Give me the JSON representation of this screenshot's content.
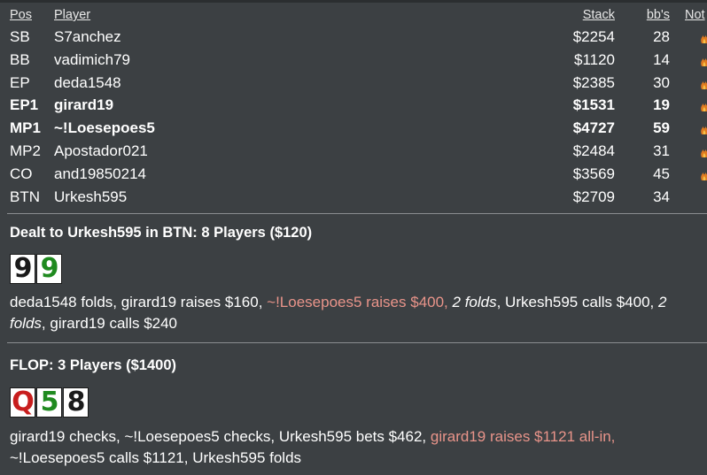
{
  "header": {
    "pos": "Pos",
    "player": "Player",
    "stack": "Stack",
    "bbs": "bb's",
    "notes": "Not"
  },
  "players": [
    {
      "pos": "SB",
      "player": "S7anchez",
      "stack": "$2254",
      "bbs": "28",
      "bold": false,
      "note": true
    },
    {
      "pos": "BB",
      "player": "vadimich79",
      "stack": "$1120",
      "bbs": "14",
      "bold": false,
      "note": true
    },
    {
      "pos": "EP",
      "player": "deda1548",
      "stack": "$2385",
      "bbs": "30",
      "bold": false,
      "note": true
    },
    {
      "pos": "EP1",
      "player": "girard19",
      "stack": "$1531",
      "bbs": "19",
      "bold": true,
      "note": true
    },
    {
      "pos": "MP1",
      "player": "~!Loesepoes5",
      "stack": "$4727",
      "bbs": "59",
      "bold": true,
      "note": true
    },
    {
      "pos": "MP2",
      "player": "Apostador021",
      "stack": "$2484",
      "bbs": "31",
      "bold": false,
      "note": true
    },
    {
      "pos": "CO",
      "player": "and19850214",
      "stack": "$3569",
      "bbs": "45",
      "bold": false,
      "note": true
    },
    {
      "pos": "BTN",
      "player": "Urkesh595",
      "stack": "$2709",
      "bbs": "34",
      "bold": false,
      "note": false
    }
  ],
  "preflop": {
    "title": "Dealt to Urkesh595 in BTN: 8 Players ($120)",
    "cards": [
      {
        "rank": "9",
        "color": "#1a1a1a"
      },
      {
        "rank": "9",
        "color": "#1f8a1f"
      }
    ],
    "actions": [
      {
        "text": "deda1548 folds, girard19 raises $160, ",
        "style": "normal"
      },
      {
        "text": "~!Loesepoes5 raises $400, ",
        "style": "hero"
      },
      {
        "text": "2 folds",
        "style": "folds"
      },
      {
        "text": ", Urkesh595 calls $400, ",
        "style": "normal"
      },
      {
        "text": "2 folds",
        "style": "folds"
      },
      {
        "text": ", girard19 calls $240",
        "style": "normal"
      }
    ]
  },
  "flop": {
    "title": "FLOP: 3 Players ($1400)",
    "cards": [
      {
        "rank": "Q",
        "color": "#c81e1e"
      },
      {
        "rank": "5",
        "color": "#1f8a1f"
      },
      {
        "rank": "8",
        "color": "#1a1a1a"
      }
    ],
    "actions": [
      {
        "text": "girard19 checks, ~!Loesepoes5 checks, Urkesh595 bets $462, ",
        "style": "normal"
      },
      {
        "text": "girard19 raises $1121 all-in, ",
        "style": "hero"
      },
      {
        "text": "~!Loesepoes5 calls $1121, Urkesh595 folds",
        "style": "normal"
      }
    ]
  },
  "colors": {
    "background": "#3c4043",
    "highlight_action": "#e9948a",
    "note_icon": "#e07a1f"
  },
  "icons": {
    "note": "note-flame-icon"
  }
}
